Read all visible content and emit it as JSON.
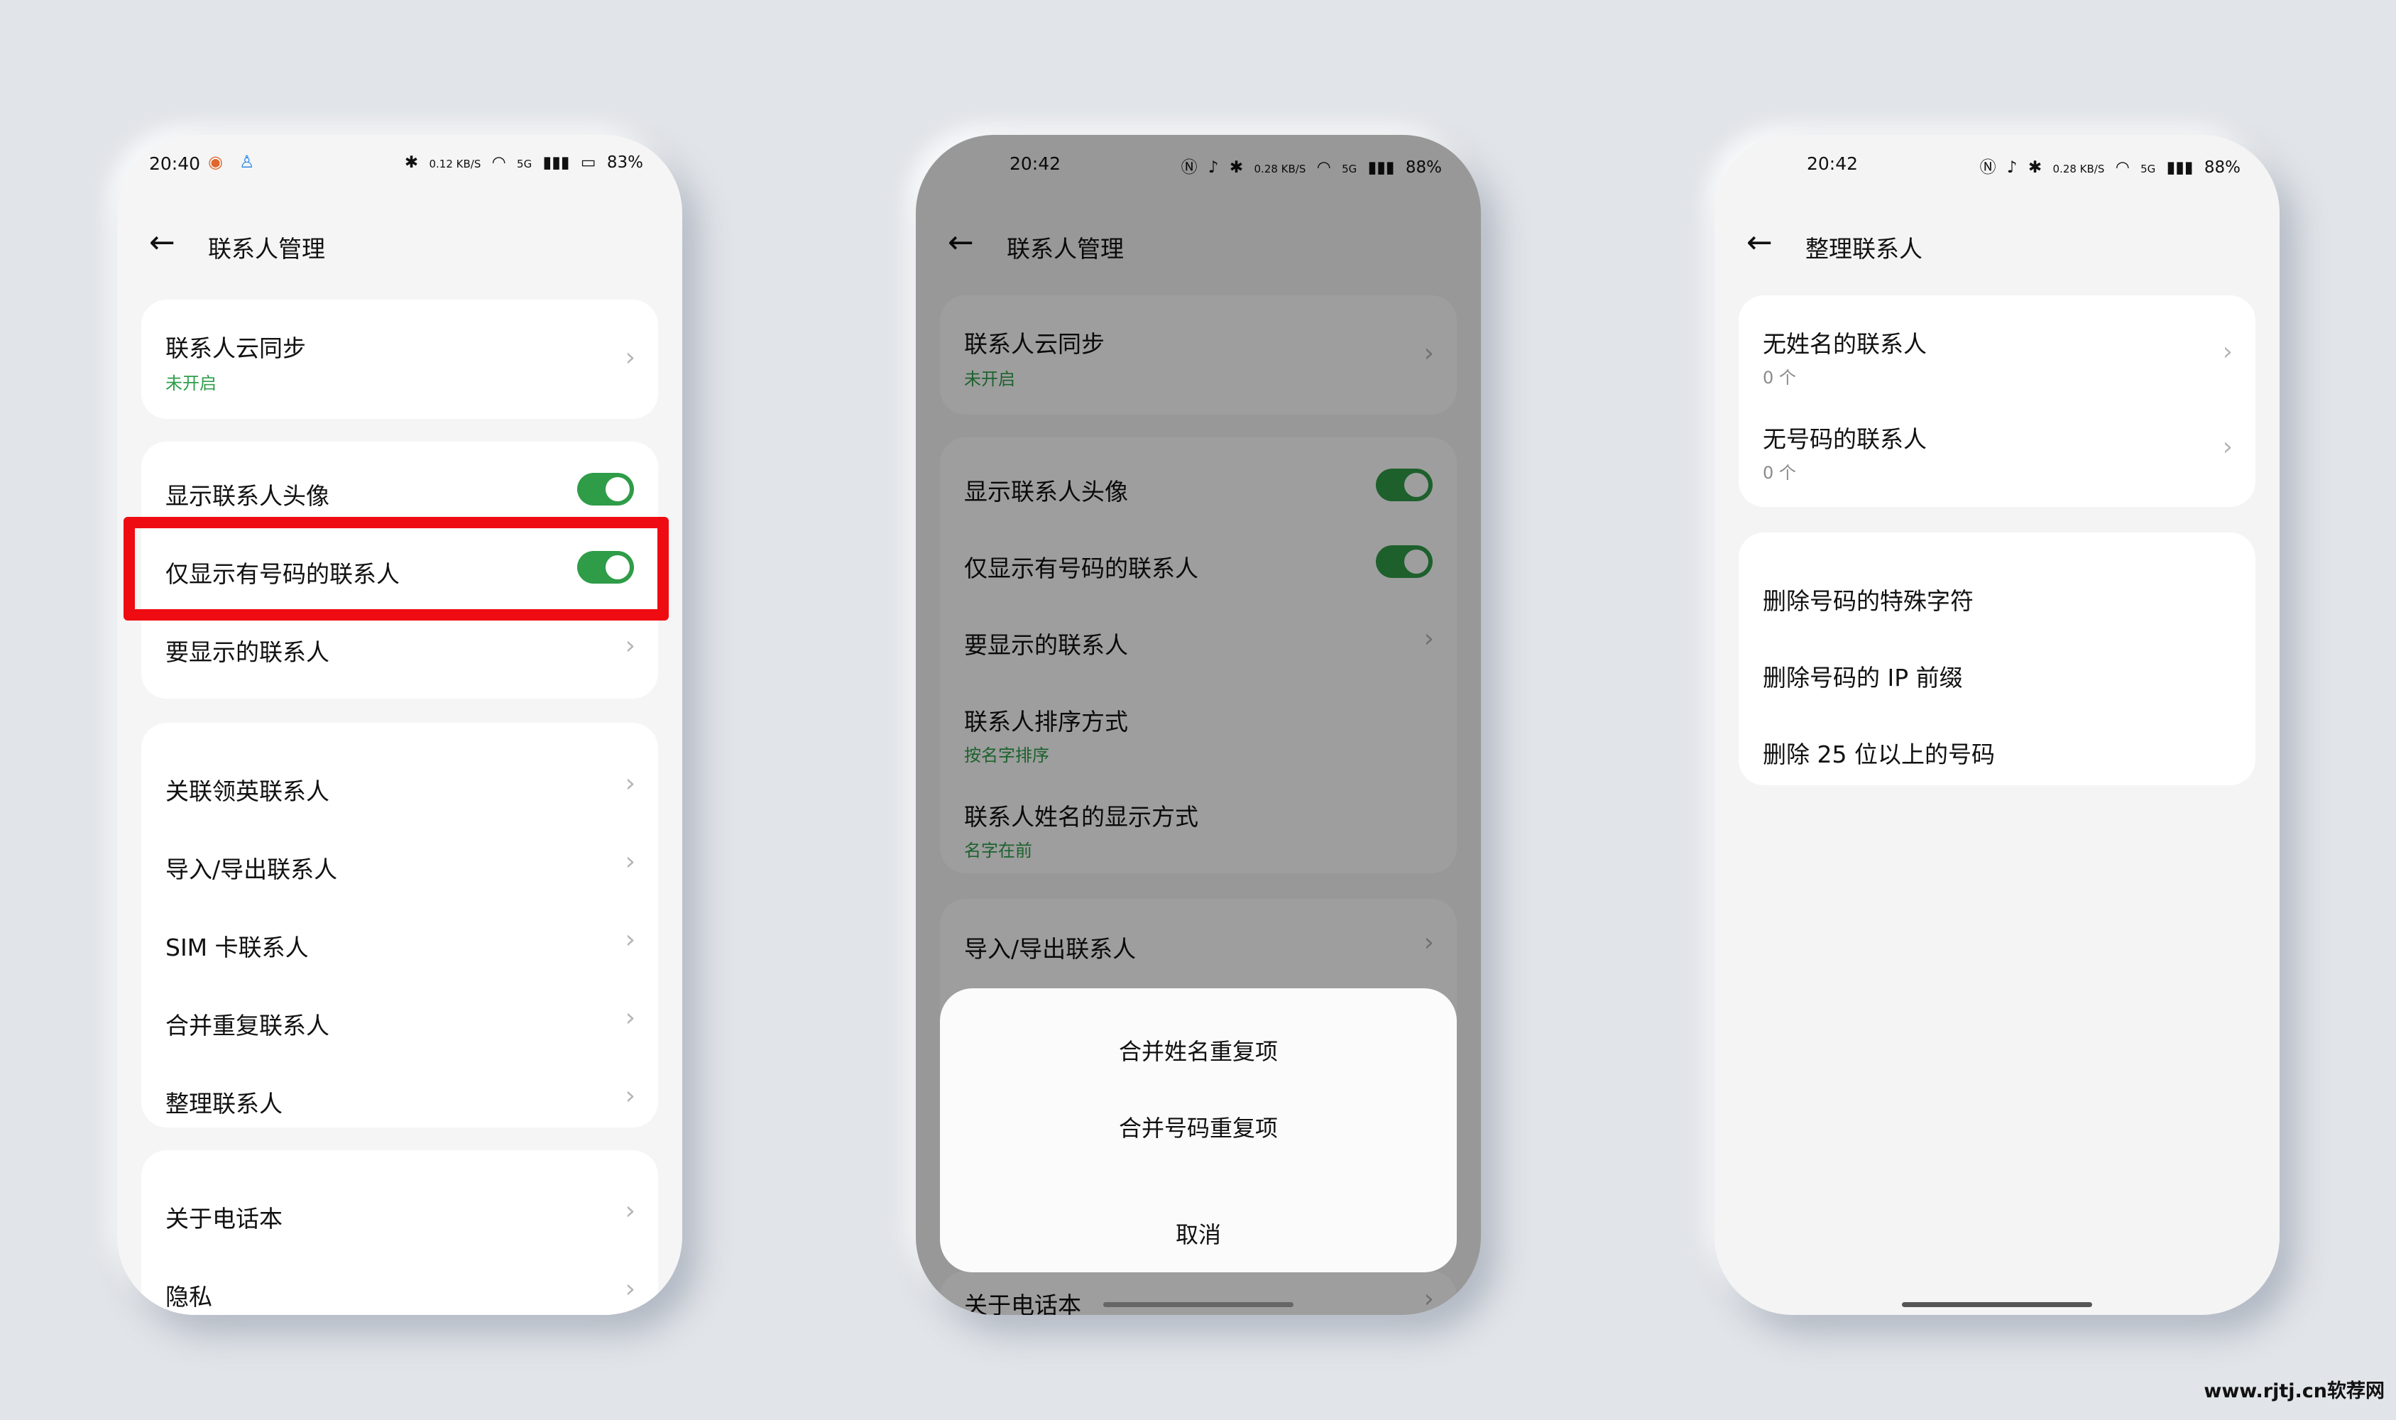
{
  "phone1": {
    "status": {
      "time": "20:40",
      "net_speed": "0.12 KB/S",
      "signal": "5G",
      "battery": "83%"
    },
    "title": "联系人管理",
    "sync": {
      "label": "联系人云同步",
      "sub": "未开启"
    },
    "toggles": [
      {
        "label": "显示联系人头像",
        "on": true
      },
      {
        "label": "仅显示有号码的联系人",
        "on": true
      }
    ],
    "display_contacts": "要显示的联系人",
    "list": [
      "关联领英联系人",
      "导入/导出联系人",
      "SIM 卡联系人",
      "合并重复联系人",
      "整理联系人"
    ],
    "about": "关于电话本",
    "privacy": "隐私"
  },
  "phone2": {
    "status": {
      "time": "20:42",
      "net_speed": "0.28 KB/S",
      "signal": "5G",
      "battery": "88%"
    },
    "title": "联系人管理",
    "sync": {
      "label": "联系人云同步",
      "sub": "未开启"
    },
    "toggles": [
      {
        "label": "显示联系人头像",
        "on": true
      },
      {
        "label": "仅显示有号码的联系人",
        "on": true
      }
    ],
    "display_contacts": "要显示的联系人",
    "sort": {
      "label": "联系人排序方式",
      "sub": "按名字排序"
    },
    "name_display": {
      "label": "联系人姓名的显示方式",
      "sub": "名字在前"
    },
    "import_export": "导入/导出联系人",
    "about": "关于电话本",
    "sheet": {
      "merge_name": "合并姓名重复项",
      "merge_number": "合并号码重复项",
      "cancel": "取消"
    }
  },
  "phone3": {
    "status": {
      "time": "20:42",
      "net_speed": "0.28 KB/S",
      "signal": "5G",
      "battery": "88%"
    },
    "title": "整理联系人",
    "no_name": {
      "label": "无姓名的联系人",
      "count": "0 个"
    },
    "no_number": {
      "label": "无号码的联系人",
      "count": "0 个"
    },
    "actions": [
      "删除号码的特殊字符",
      "删除号码的 IP 前缀",
      "删除 25 位以上的号码"
    ]
  },
  "watermark": "www.rjtj.cn软荐网",
  "colors": {
    "accent_green": "#2f9c48",
    "highlight_red": "#ee0c12",
    "background": "#e1e4e8"
  },
  "icons": [
    "back-arrow-icon",
    "chevron-right-icon",
    "bluetooth-icon",
    "wifi-icon",
    "battery-icon",
    "nfc-icon",
    "mute-icon"
  ]
}
